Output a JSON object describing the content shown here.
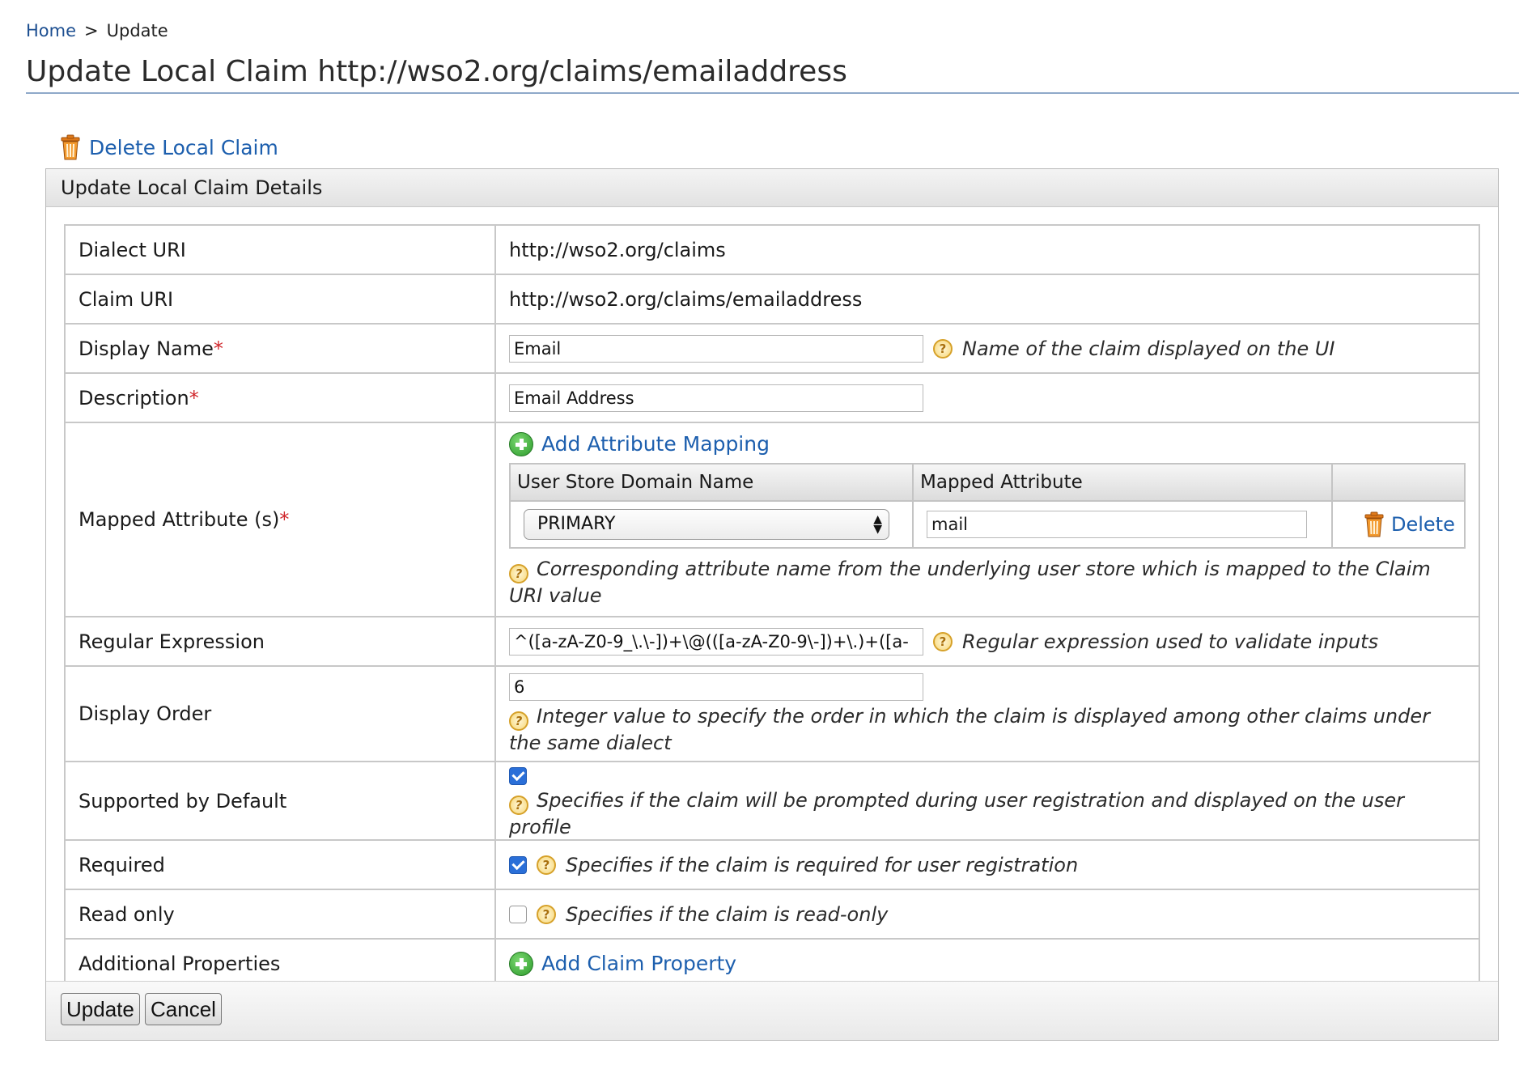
{
  "breadcrumb": {
    "home": "Home",
    "separator": ">",
    "current": "Update"
  },
  "page_title": "Update Local Claim http://wso2.org/claims/emailaddress",
  "delete_claim_label": "Delete Local Claim",
  "panel": {
    "header": "Update Local Claim Details",
    "rows": {
      "dialect_uri": {
        "label": "Dialect URI",
        "value": "http://wso2.org/claims"
      },
      "claim_uri": {
        "label": "Claim URI",
        "value": "http://wso2.org/claims/emailaddress"
      },
      "display_name": {
        "label": "Display Name",
        "required_mark": "*",
        "value": "Email",
        "help": "Name of the claim displayed on the UI"
      },
      "description": {
        "label": "Description",
        "required_mark": "*",
        "value": "Email Address"
      },
      "mapped_attributes": {
        "label": "Mapped Attribute (s)",
        "required_mark": "*",
        "add_label": "Add Attribute Mapping",
        "columns": [
          "User Store Domain Name",
          "Mapped Attribute",
          ""
        ],
        "mappings": [
          {
            "domain": "PRIMARY",
            "attribute": "mail",
            "delete_label": "Delete"
          }
        ],
        "help": "Corresponding attribute name from the underlying user store which is mapped to the Claim URI value"
      },
      "regular_expression": {
        "label": "Regular Expression",
        "value": "^([a-zA-Z0-9_\\.\\-])+\\@(([a-zA-Z0-9\\-])+\\.)+([a-",
        "help": "Regular expression used to validate inputs"
      },
      "display_order": {
        "label": "Display Order",
        "value": "6",
        "help": "Integer value to specify the order in which the claim is displayed among other claims under the same dialect"
      },
      "supported_by_default": {
        "label": "Supported by Default",
        "checked": true,
        "help": "Specifies if the claim will be prompted during user registration and displayed on the user profile"
      },
      "required": {
        "label": "Required",
        "checked": true,
        "help": "Specifies if the claim is required for user registration"
      },
      "read_only": {
        "label": "Read only",
        "checked": false,
        "help": "Specifies if the claim is read-only"
      },
      "additional_properties": {
        "label": "Additional Properties",
        "add_label": "Add Claim Property"
      }
    }
  },
  "buttons": {
    "update": "Update",
    "cancel": "Cancel"
  },
  "help_glyph": "?",
  "colors": {
    "link": "#1d5fae",
    "required": "#d0262b",
    "checkbox": "#2a6fd8"
  }
}
